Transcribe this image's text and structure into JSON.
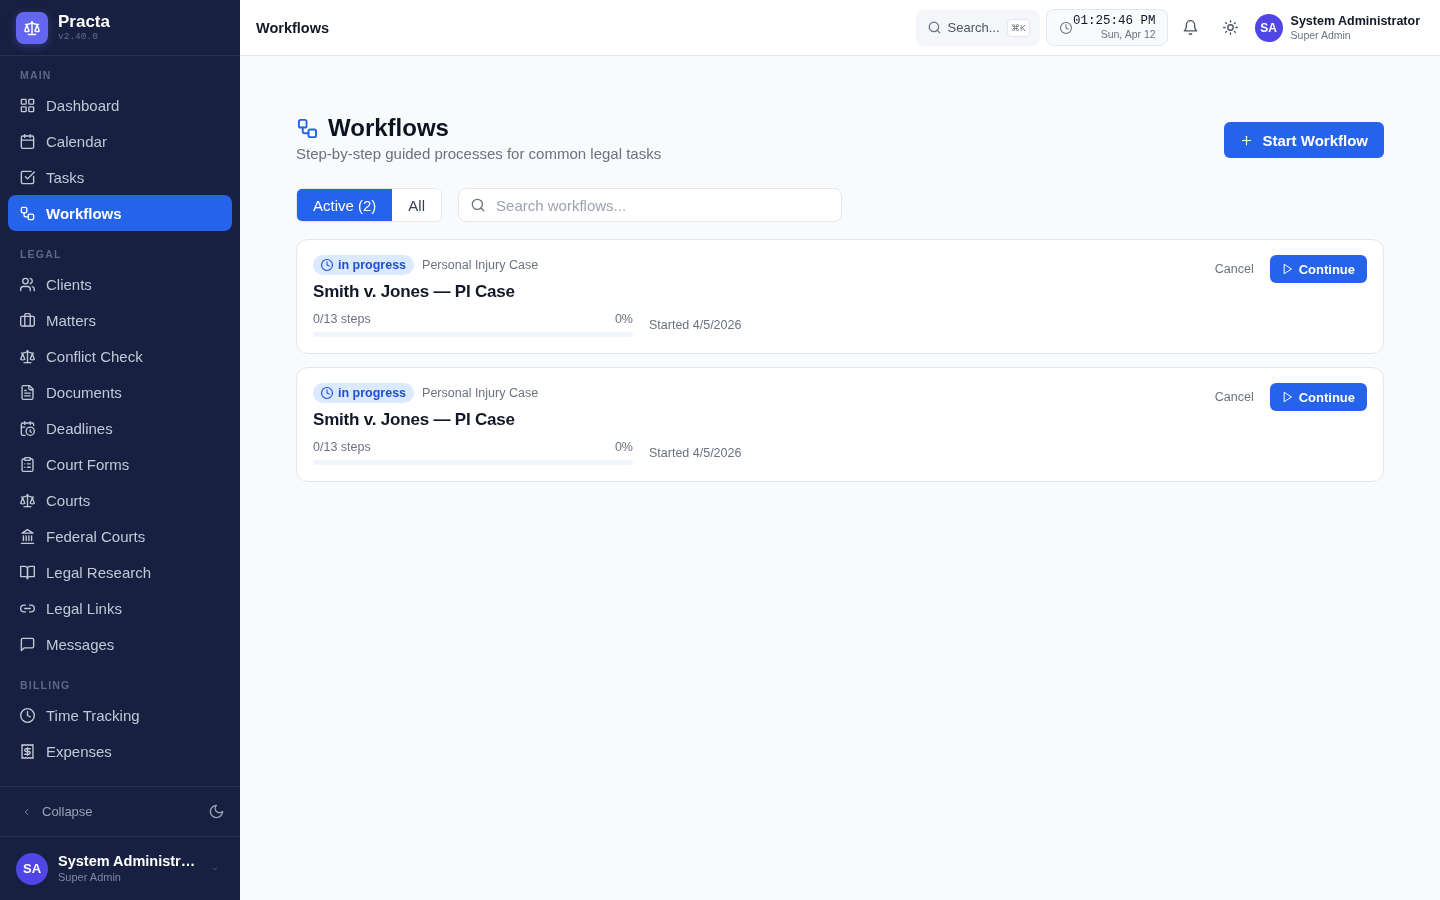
{
  "sidebar": {
    "brand": {
      "name": "Practa",
      "version": "v2.40.0"
    },
    "sections": [
      {
        "label": "MAIN",
        "items": [
          {
            "label": "Dashboard",
            "selected": false
          },
          {
            "label": "Calendar",
            "selected": false
          },
          {
            "label": "Tasks",
            "selected": false
          },
          {
            "label": "Workflows",
            "selected": true
          }
        ]
      },
      {
        "label": "LEGAL",
        "items": [
          {
            "label": "Clients",
            "selected": false
          },
          {
            "label": "Matters",
            "selected": false
          },
          {
            "label": "Conflict Check",
            "selected": false
          },
          {
            "label": "Documents",
            "selected": false
          },
          {
            "label": "Deadlines",
            "selected": false
          },
          {
            "label": "Court Forms",
            "selected": false
          },
          {
            "label": "Courts",
            "selected": false
          },
          {
            "label": "Federal Courts",
            "selected": false
          },
          {
            "label": "Legal Research",
            "selected": false
          },
          {
            "label": "Legal Links",
            "selected": false
          },
          {
            "label": "Messages",
            "selected": false
          }
        ]
      },
      {
        "label": "BILLING",
        "items": [
          {
            "label": "Time Tracking",
            "selected": false
          },
          {
            "label": "Expenses",
            "selected": false
          }
        ]
      }
    ],
    "collapse": "Collapse",
    "user": {
      "initials": "SA",
      "name": "System Administr…",
      "role": "Super Admin"
    }
  },
  "topbar": {
    "title": "Workflows",
    "search": {
      "label": "Search...",
      "shortcut": "⌘K"
    },
    "clock": {
      "time": "01:25:46 PM",
      "date": "Sun, Apr 12"
    },
    "user": {
      "initials": "SA",
      "name": "System Administrator",
      "role": "Super Admin"
    }
  },
  "page": {
    "title": "Workflows",
    "subtitle": "Step-by-step guided processes for common legal tasks",
    "primary_action": "Start Workflow",
    "filters": [
      {
        "label": "Active (2)",
        "selected": true
      },
      {
        "label": "All",
        "selected": false
      }
    ],
    "search": {
      "placeholder": "Search workflows..."
    },
    "workflows": [
      {
        "status": "in progress",
        "template": "Personal Injury Case",
        "title": "Smith v. Jones — PI Case",
        "steps": "0/13 steps",
        "percent": "0%",
        "started": "Started 4/5/2026",
        "cancel": "Cancel",
        "continue": "Continue"
      },
      {
        "status": "in progress",
        "template": "Personal Injury Case",
        "title": "Smith v. Jones — PI Case",
        "steps": "0/13 steps",
        "percent": "0%",
        "started": "Started 4/5/2026",
        "cancel": "Cancel",
        "continue": "Continue"
      }
    ]
  }
}
